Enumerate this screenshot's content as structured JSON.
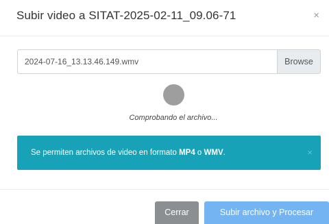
{
  "modal": {
    "title": "Subir video a SITAT-2025-02-11_09.06-71",
    "close_symbol": "×"
  },
  "file": {
    "value": "2024-07-16_13.13.46.149.wmv",
    "browse_label": "Browse"
  },
  "status": {
    "text": "Comprobando el archivo..."
  },
  "alert": {
    "prefix": "Se permiten archivos de video en formato ",
    "format1": "MP4",
    "joiner": " o ",
    "format2": "WMV",
    "suffix": ".",
    "close_symbol": "×"
  },
  "footer": {
    "cancel_label": "Cerrar",
    "submit_label": "Subir archivo y Procesar"
  },
  "colors": {
    "alert_bg": "#17a2b8",
    "cancel_bg": "#8c8f92",
    "submit_bg": "#74b4f2",
    "spinner": "#9e9e9e"
  },
  "icons": {
    "close": "close-icon",
    "spinner": "loading-spinner-icon"
  }
}
